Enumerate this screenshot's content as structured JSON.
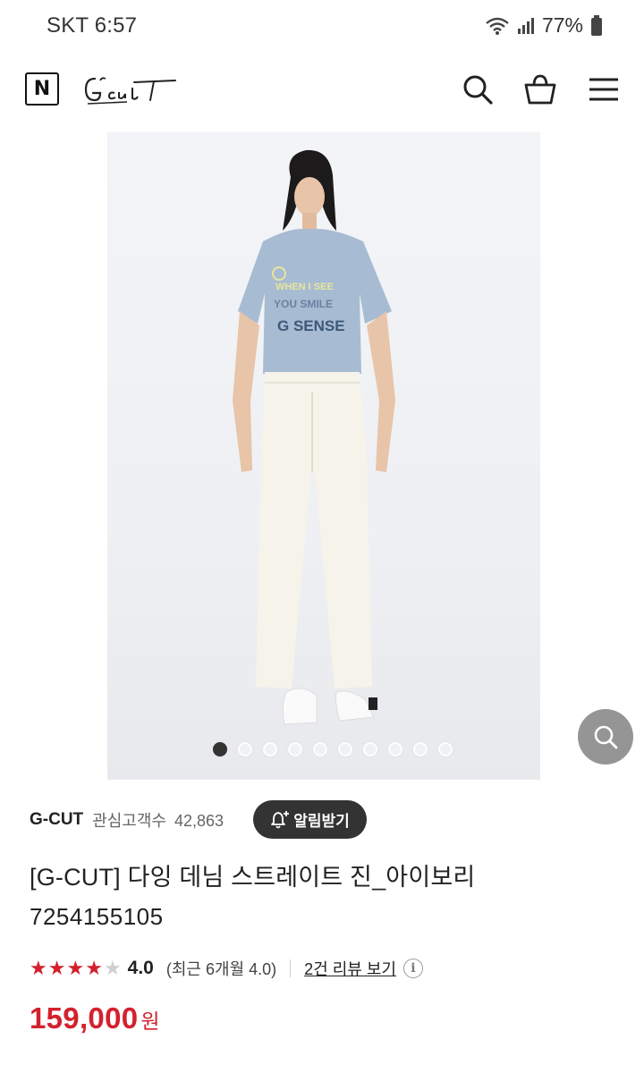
{
  "status_bar": {
    "carrier_time": "SKT 6:57",
    "battery": "77%"
  },
  "header": {
    "n_logo": "N",
    "brand_logo": "G-cut",
    "icons": [
      "search-icon",
      "shopping-bag-icon",
      "hamburger-menu-icon"
    ]
  },
  "gallery": {
    "total_images": 10,
    "active_index": 0
  },
  "store": {
    "name": "G-CUT",
    "interest_label": "관심고객수",
    "interest_count": "42,863",
    "alarm_button": "알림받기"
  },
  "product": {
    "title": "[G-CUT] 다잉 데님 스트레이트 진_아이보리",
    "code": "7254155105",
    "rating": {
      "stars_filled": 4,
      "stars_total": 5,
      "value": "4.0",
      "recent": "(최근 6개월 4.0)",
      "review_link": "2건 리뷰 보기"
    },
    "price": "159,000",
    "currency": "원"
  },
  "colors": {
    "accent_red": "#d3212d",
    "dark_button": "#333333"
  }
}
